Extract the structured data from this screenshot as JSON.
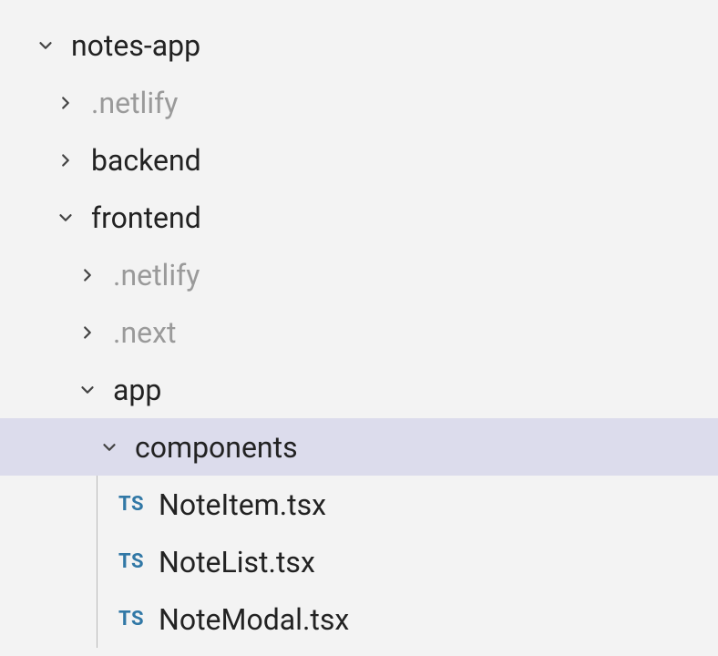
{
  "tree": {
    "items": [
      {
        "label": "notes-app",
        "type": "folder",
        "expanded": true,
        "indent": 0,
        "dimmed": false,
        "selected": false
      },
      {
        "label": ".netlify",
        "type": "folder",
        "expanded": false,
        "indent": 1,
        "dimmed": true,
        "selected": false
      },
      {
        "label": "backend",
        "type": "folder",
        "expanded": false,
        "indent": 1,
        "dimmed": false,
        "selected": false
      },
      {
        "label": "frontend",
        "type": "folder",
        "expanded": true,
        "indent": 1,
        "dimmed": false,
        "selected": false
      },
      {
        "label": ".netlify",
        "type": "folder",
        "expanded": false,
        "indent": 2,
        "dimmed": true,
        "selected": false
      },
      {
        "label": ".next",
        "type": "folder",
        "expanded": false,
        "indent": 2,
        "dimmed": true,
        "selected": false
      },
      {
        "label": "app",
        "type": "folder",
        "expanded": true,
        "indent": 2,
        "dimmed": false,
        "selected": false
      },
      {
        "label": "components",
        "type": "folder",
        "expanded": true,
        "indent": 3,
        "dimmed": false,
        "selected": true
      },
      {
        "label": "NoteItem.tsx",
        "type": "file",
        "fileIcon": "TS",
        "indent": 4,
        "dimmed": false,
        "selected": false
      },
      {
        "label": "NoteList.tsx",
        "type": "file",
        "fileIcon": "TS",
        "indent": 4,
        "dimmed": false,
        "selected": false
      },
      {
        "label": "NoteModal.tsx",
        "type": "file",
        "fileIcon": "TS",
        "indent": 4,
        "dimmed": false,
        "selected": false
      }
    ]
  }
}
